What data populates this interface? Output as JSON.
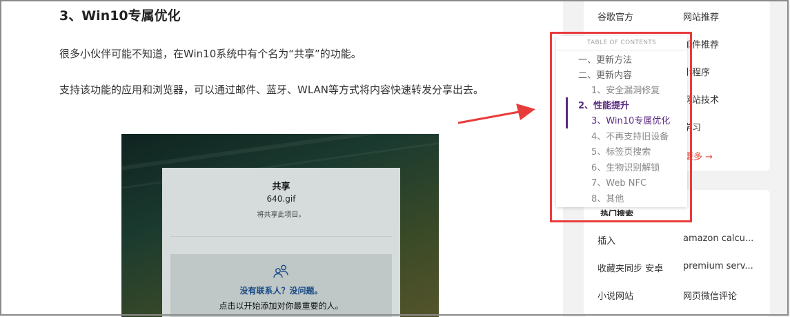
{
  "article": {
    "heading": "3、Win10专属优化",
    "paragraphs": [
      "很多小伙伴可能不知道，在Win10系统中有个名为“共享”的功能。",
      "支持该功能的应用和浏览器，可以通过邮件、蓝牙、WLAN等方式将内容快速转发分享出去。"
    ]
  },
  "share_dialog": {
    "title": "共享",
    "file": "640.gif",
    "subtitle": "将共享此项目。",
    "contact_title": "没有联系人？没问题。",
    "contact_desc": "点击以开始添加对你最重要的人。",
    "icon": "people-icon"
  },
  "toc": {
    "header": "TABLE OF CONTENTS",
    "items": [
      {
        "label": "一、更新方法",
        "level": 1
      },
      {
        "label": "二、更新内容",
        "level": 1
      },
      {
        "label": "1、安全漏洞修复",
        "level": 2
      },
      {
        "label": "2、性能提升",
        "level": 1,
        "active": true
      },
      {
        "label": "3、Win10专属优化",
        "level": 2,
        "current": true
      },
      {
        "label": "4、不再支持旧设备",
        "level": 2
      },
      {
        "label": "5、标签页搜索",
        "level": 2
      },
      {
        "label": "6、生物识别解锁",
        "level": 2
      },
      {
        "label": "7、Web NFC",
        "level": 2
      },
      {
        "label": "8、其他",
        "level": 2
      }
    ],
    "accent_color": "#5b2a82",
    "highlight_color": "#ea3b3b"
  },
  "sidebar": {
    "card1": {
      "left_links": [
        "谷歌官方"
      ],
      "right_links": [
        "网站推荐",
        "邮件推荐",
        "小程序",
        "网站技术",
        "学习"
      ],
      "more_link": "查看更多 →"
    },
    "card2": {
      "title": "热门搜索",
      "rows": [
        {
          "left": "插入",
          "right": "amazon calcu..."
        },
        {
          "left": "收藏夹同步 安卓",
          "right": "premium serv..."
        },
        {
          "left": "小说网站",
          "right": "网页微信评论"
        }
      ]
    }
  }
}
